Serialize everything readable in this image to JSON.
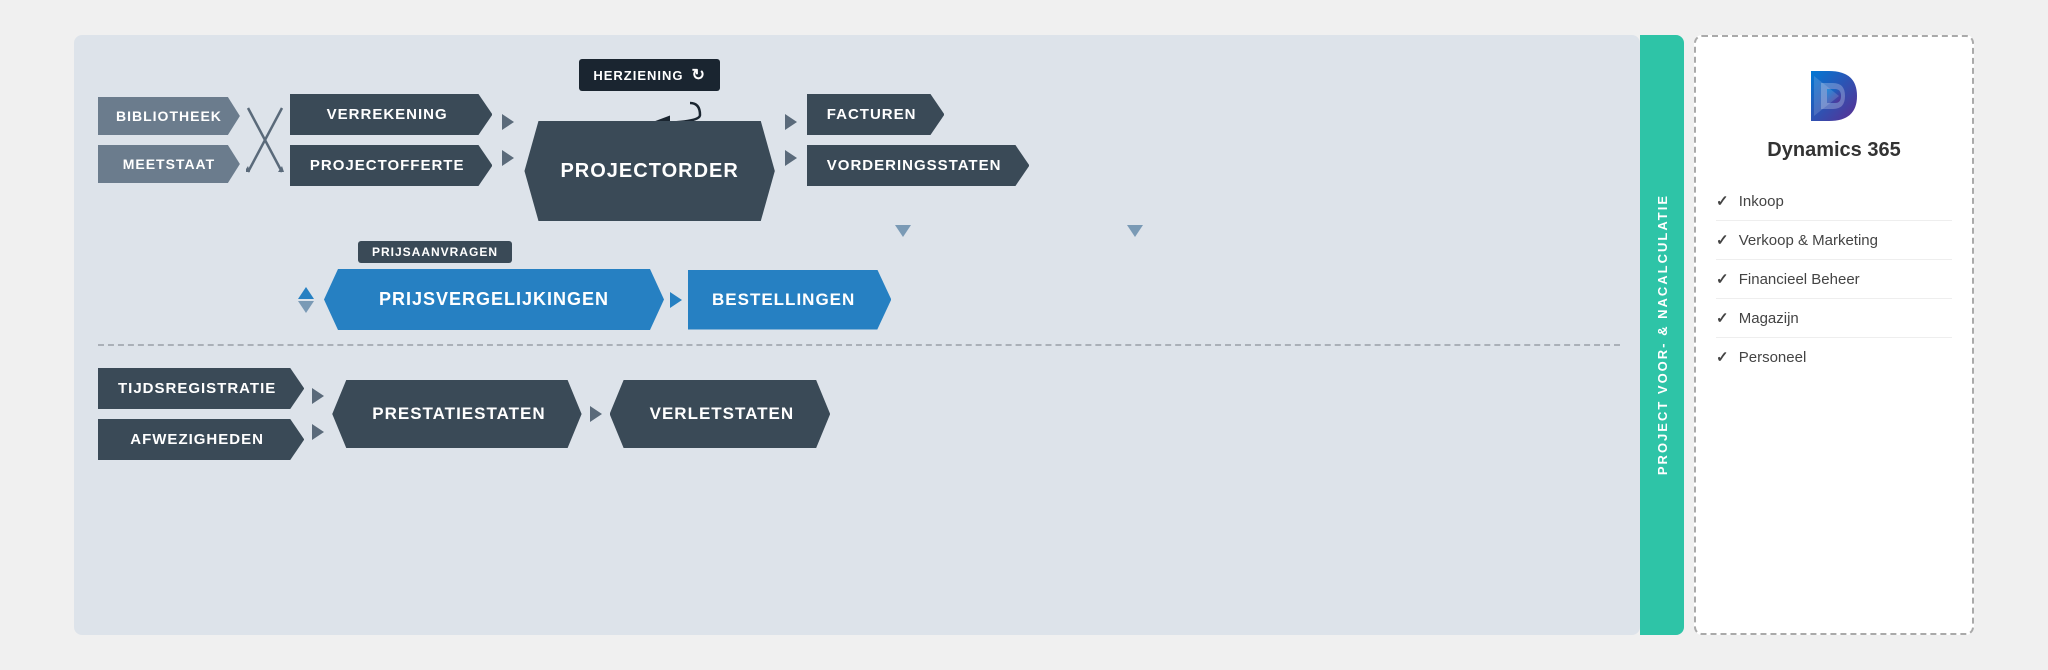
{
  "diagram": {
    "title": "PROJECT VOOR- & NACALCULATIE",
    "nodes": {
      "bibliotheek": "BIBLIOTHEEK",
      "meetstaat": "MEETSTAAT",
      "verrekening": "VERREKENING",
      "projectofferte": "PROJECTOFFERTE",
      "herziening": "HERZIENING",
      "projectorder": "PROJECTORDER",
      "facturen": "FACTUREN",
      "vorderingsstaten": "VORDERINGSSTATEN",
      "prijsaanvragen": "PRIJSAANVRAGEN",
      "prijsvergelijkingen": "PRIJSVERGELIJKINGEN",
      "bestellingen": "BESTELLINGEN",
      "tijdsregistratie": "TIJDSREGISTRATIE",
      "afwezigheden": "AFWEZIGHEDEN",
      "prestatiestaten": "PRESTATIESTATEN",
      "verletstaten": "VERLETSTATEN"
    },
    "refresh_icon": "↻"
  },
  "dynamics": {
    "title": "Dynamics 365",
    "checklist": [
      "Inkoop",
      "Verkoop & Marketing",
      "Financieel Beheer",
      "Magazijn",
      "Personeel"
    ]
  }
}
